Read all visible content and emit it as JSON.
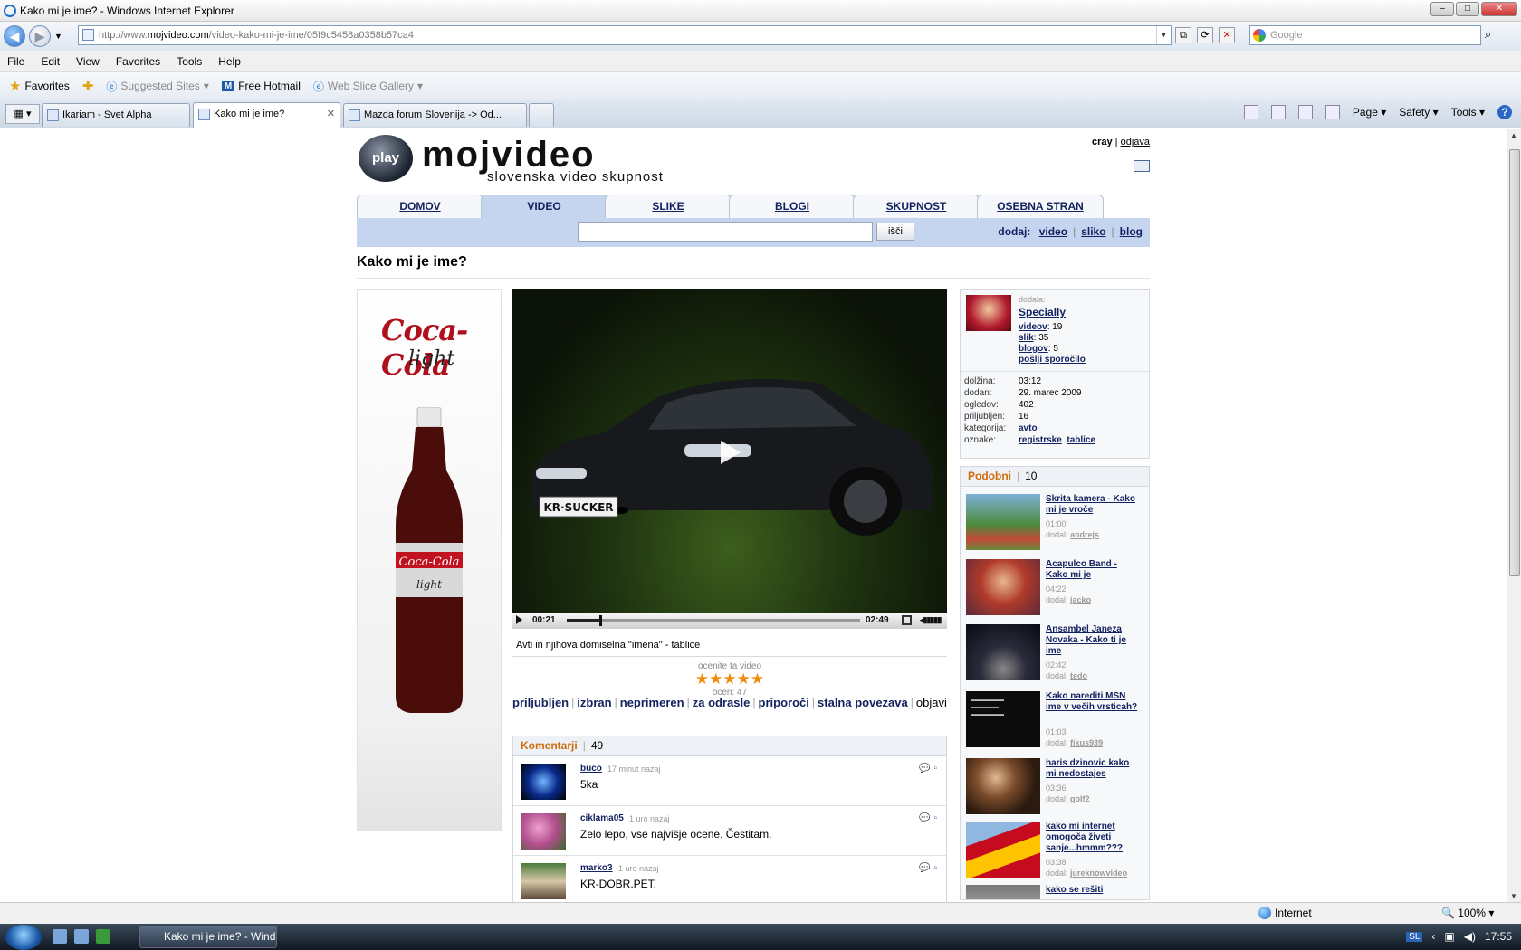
{
  "browser": {
    "title": "Kako mi je ime? - Windows Internet Explorer",
    "address": {
      "domain_prefix": "http://www.",
      "domain": "mojvideo.com",
      "path": "/video-kako-mi-je-ime/05f9c5458a0358b57ca4"
    },
    "search_placeholder": "Google",
    "menu": [
      "File",
      "Edit",
      "View",
      "Favorites",
      "Tools",
      "Help"
    ],
    "favorites_bar": {
      "favorites": "Favorites",
      "suggested": "Suggested Sites",
      "hotmail": "Free Hotmail",
      "webslice": "Web Slice Gallery"
    },
    "tabs": [
      {
        "label": "Ikariam - Svet Alpha",
        "active": false
      },
      {
        "label": "Kako mi je ime?",
        "active": true
      },
      {
        "label": "Mazda forum Slovenija -> Od...",
        "active": false
      }
    ],
    "command_bar": {
      "page": "Page",
      "safety": "Safety",
      "tools": "Tools"
    },
    "status": {
      "zone": "Internet",
      "zoom": "100%"
    }
  },
  "taskbar": {
    "task": "Kako mi je ime? - Wind...",
    "lang": "SL",
    "clock": "17:55"
  },
  "site": {
    "logo_badge": "play",
    "logo_name": "mojvideo",
    "logo_sub": "slovenska video skupnost",
    "user": {
      "name": "cray",
      "logout": "odjava"
    },
    "nav": [
      "DOMOV",
      "VIDEO",
      "SLIKE",
      "BLOGI",
      "SKUPNOST",
      "OSEBNA STRAN"
    ],
    "search_button": "išči",
    "add": {
      "label": "dodaj:",
      "video": "video",
      "image": "sliko",
      "blog": "blog"
    },
    "page_title": "Kako mi je ime?",
    "ad": {
      "brand": "Coca-Cola",
      "sub": "light",
      "bottle_brand": "Coca-Cola",
      "bottle_sub": "light"
    },
    "player": {
      "plate": "KR·SUCKER",
      "time_current": "00:21",
      "time_total": "02:49",
      "progress": 0.11
    },
    "video_description": "Avti in njihova domiselna \"imena\" - tablice",
    "rating": {
      "prompt": "ocenite ta video",
      "stars": "★★★★★",
      "count_label": "ocen: 47"
    },
    "actions": [
      "priljubljen",
      "izbran",
      "neprimeren",
      "za odrasle",
      "priporoči",
      "stalna povezava",
      "objavi"
    ],
    "comments": {
      "label": "Komentarji",
      "count": "49",
      "items": [
        {
          "user": "buco",
          "when": "17 minut nazaj",
          "text": "5ka"
        },
        {
          "user": "ciklama05",
          "when": "1 uro nazaj",
          "text": "Zelo lepo, vse najvišje ocene. Čestitam."
        },
        {
          "user": "marko3",
          "when": "1 uro nazaj",
          "text": "KR-DOBR.PET."
        }
      ]
    },
    "uploader": {
      "added_label": "dodala:",
      "name": "Specially",
      "videos_label": "videov",
      "videos": "19",
      "images_label": "slik",
      "images": "35",
      "blogs_label": "blogov",
      "blogs": "5",
      "message": "pošlji sporočilo"
    },
    "details": [
      {
        "k": "dolžina:",
        "v": "03:12"
      },
      {
        "k": "dodan:",
        "v": "29. marec 2009"
      },
      {
        "k": "ogledov:",
        "v": "402"
      },
      {
        "k": "priljubljen:",
        "v": "16"
      },
      {
        "k": "kategorija:",
        "v": "avto"
      },
      {
        "k": "oznake:",
        "v": "registrske",
        "v2": "tablice"
      }
    ],
    "similar": {
      "label": "Podobni",
      "count": "10",
      "items": [
        {
          "title": "Skrita kamera - Kako mi je vroče",
          "duration": "01:00",
          "by": "andrejs"
        },
        {
          "title": "Acapulco Band - Kako mi je",
          "duration": "04:22",
          "by": "jacko"
        },
        {
          "title": "Ansambel Janeza Novaka - Kako ti je ime",
          "duration": "02:42",
          "by": "tedo"
        },
        {
          "title": "Kako narediti MSN ime v večih vrsticah?",
          "duration": "01:03",
          "by": "fikus939"
        },
        {
          "title": "haris dzinovic kako mi nedostajes",
          "duration": "03:36",
          "by": "golf2"
        },
        {
          "title": "kako mi internet omogoča živeti sanje...hmmm???",
          "duration": "03:38",
          "by": "jureknowvideo"
        },
        {
          "title": "kako se rešiti",
          "duration": "",
          "by": ""
        }
      ],
      "added_by_label": "dodal:"
    }
  }
}
